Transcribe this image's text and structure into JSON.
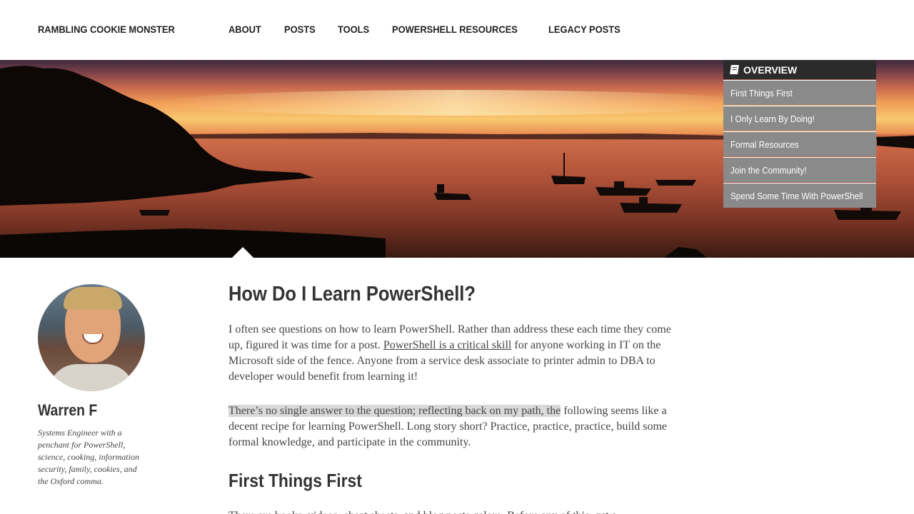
{
  "site": {
    "title": "RAMBLING COOKIE MONSTER"
  },
  "nav": [
    {
      "label": "ABOUT"
    },
    {
      "label": "POSTS"
    },
    {
      "label": "TOOLS"
    },
    {
      "label": "POWERSHELL RESOURCES"
    },
    {
      "label": "LEGACY POSTS"
    }
  ],
  "toc": {
    "icon": "book-icon",
    "title": "OVERVIEW",
    "items": [
      {
        "label": "First Things First"
      },
      {
        "label": "I Only Learn By Doing!"
      },
      {
        "label": "Formal Resources"
      },
      {
        "label": "Join the Community!"
      },
      {
        "label": "Spend Some Time With PowerShell"
      }
    ]
  },
  "author": {
    "name": "Warren F",
    "bio": "Systems Engineer with a penchant for PowerShell, science, cooking, information security, family, cookies, and the Oxford comma."
  },
  "article": {
    "title": "How Do I Learn PowerShell?",
    "p1_before": "I often see questions on how to learn PowerShell. Rather than address these each time they come up, figured it was time for a post. ",
    "p1_link": "PowerShell is a critical skill",
    "p1_after": " for anyone working in IT on the Microsoft side of the fence. Anyone from a service desk associate to printer admin to DBA to developer would benefit from learning it!",
    "p2_highlight": "There’s no single answer to the question; reflecting back on my path, the",
    "p2_rest": " following seems like a decent recipe for learning PowerShell. Long story short? Practice, practice, practice, build some formal knowledge, and participate in the community.",
    "h2": "First Things First",
    "p3": "There are books, videos, cheat sheets, and blog posts galore. Before any of this, get a"
  }
}
